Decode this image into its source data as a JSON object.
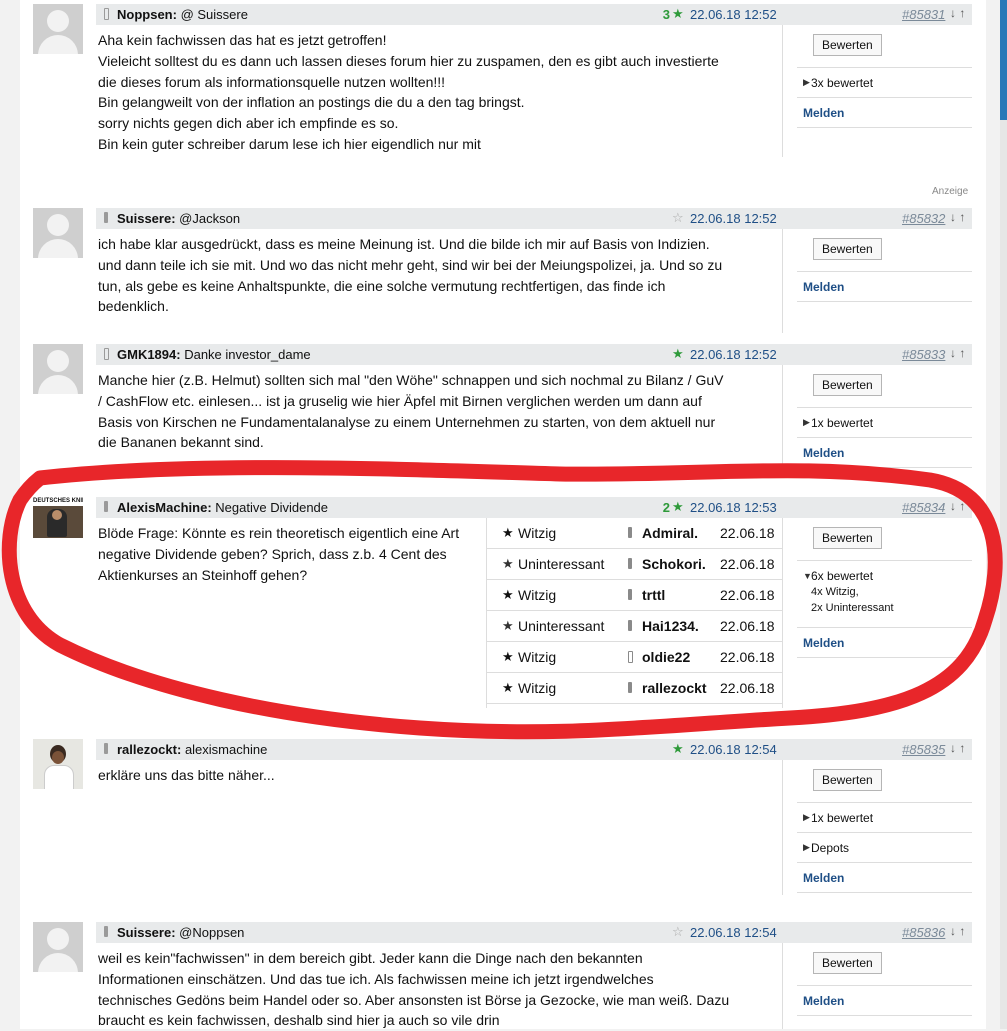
{
  "posts": [
    {
      "author": "Noppsen:",
      "subject": "@ Suissere",
      "rating_count": "3",
      "date": "22.06.18 12:52",
      "post_id": "#85831",
      "arrows": "↓ ↑",
      "lines": [
        "Aha kein fachwissen das hat es jetzt getroffen!",
        "Vieleicht solltest du es dann uch lassen dieses forum hier zu zuspamen, den es gibt auch investierte",
        "die dieses forum als informationsquelle nutzen wollten!!!",
        "Bin gelangweilt von der inflation an postings die du a den tag bringst.",
        "sorry nichts gegen dich aber ich empfinde es so.",
        "Bin kein guter schreiber darum lese ich hier eigendlich nur mit"
      ],
      "button": "Bewerten",
      "rated": "3x bewertet",
      "report": "Melden"
    },
    {
      "author": "Suissere:",
      "subject": "@Jackson",
      "date": "22.06.18 12:52",
      "post_id": "#85832",
      "arrows": "↓ ↑",
      "lines": [
        "ich habe klar ausgedrückt, dass es meine Meinung ist. Und die bilde ich mir auf Basis von Indizien.",
        "und dann teile ich sie mit. Und wo das nicht mehr geht, sind wir bei der Meiungspolizei, ja. Und so zu",
        "tun, als gebe es keine Anhaltspunkte, die eine solche vermutung rechtfertigen, das finde ich",
        "bedenklich."
      ],
      "button": "Bewerten",
      "report": "Melden"
    },
    {
      "author": "GMK1894:",
      "subject": "Danke investor_dame",
      "date": "22.06.18 12:52",
      "post_id": "#85833",
      "arrows": "↓ ↑",
      "lines": [
        "Manche hier (z.B. Helmut) sollten sich mal \"den Wöhe\" schnappen und sich nochmal zu Bilanz / GuV",
        "/ CashFlow etc. einlesen... ist ja gruselig wie hier Äpfel mit Birnen verglichen werden um dann auf",
        "Basis von Kirschen ne Fundamentalanalyse zu einem Unternehmen zu starten, von dem aktuell nur",
        "die Bananen bekannt sind."
      ],
      "button": "Bewerten",
      "rated": "1x bewertet",
      "report": "Melden"
    },
    {
      "author": "AlexisMachine:",
      "subject": "Negative Dividende",
      "rating_count": "2",
      "date": "22.06.18 12:53",
      "post_id": "#85834",
      "arrows": "↓ ↑",
      "lines": [
        "Blöde Frage: Könnte es rein theoretisch eigentlich eine Art",
        "negative Dividende geben? Sprich, dass z.b. 4 Cent des",
        "Aktienkurses an Steinhoff gehen?"
      ],
      "ratings": [
        {
          "label": "Witzig",
          "user": "Admiral.",
          "date": "22.06.18"
        },
        {
          "label": "Uninteressant",
          "user": "Schokori.",
          "date": "22.06.18"
        },
        {
          "label": "Witzig",
          "user": "trttl",
          "date": "22.06.18"
        },
        {
          "label": "Uninteressant",
          "user": "Hai1234.",
          "date": "22.06.18"
        },
        {
          "label": "Witzig",
          "user": "oldie22",
          "date": "22.06.18"
        },
        {
          "label": "Witzig",
          "user": "rallezockt",
          "date": "22.06.18"
        }
      ],
      "button": "Bewerten",
      "rated": "6x bewertet",
      "rated_detail_1": "4x Witzig,",
      "rated_detail_2": "2x Uninteressant",
      "report": "Melden",
      "avatar_text": "DEUTSCHES KNIE"
    },
    {
      "author": "rallezockt:",
      "subject": "alexismachine",
      "date": "22.06.18 12:54",
      "post_id": "#85835",
      "arrows": "↓ ↑",
      "lines": [
        "erkläre uns das bitte näher..."
      ],
      "button": "Bewerten",
      "rated": "1x bewertet",
      "depots": "Depots",
      "report": "Melden"
    },
    {
      "author": "Suissere:",
      "subject": "@Noppsen",
      "date": "22.06.18 12:54",
      "post_id": "#85836",
      "arrows": "↓ ↑",
      "lines": [
        "weil es kein\"fachwissen\" in dem bereich gibt. Jeder kann die Dinge nach den bekannten",
        "Informationen einschätzen. Und das tue ich. Als fachwissen meine ich jetzt irgendwelches",
        "technisches Gedöns beim Handel oder so. Aber ansonsten ist Börse ja Gezocke, wie man weiß. Dazu",
        "braucht es kein fachwissen, deshalb sind hier ja auch so vile drin"
      ],
      "button": "Bewerten",
      "report": "Melden"
    }
  ],
  "ad_label": "Anzeige",
  "colors": {
    "header_bg": "#e8eaeb",
    "green_star": "#2e9a3a",
    "date_blue": "#1f4f86",
    "annotation_red": "#e8262a"
  }
}
